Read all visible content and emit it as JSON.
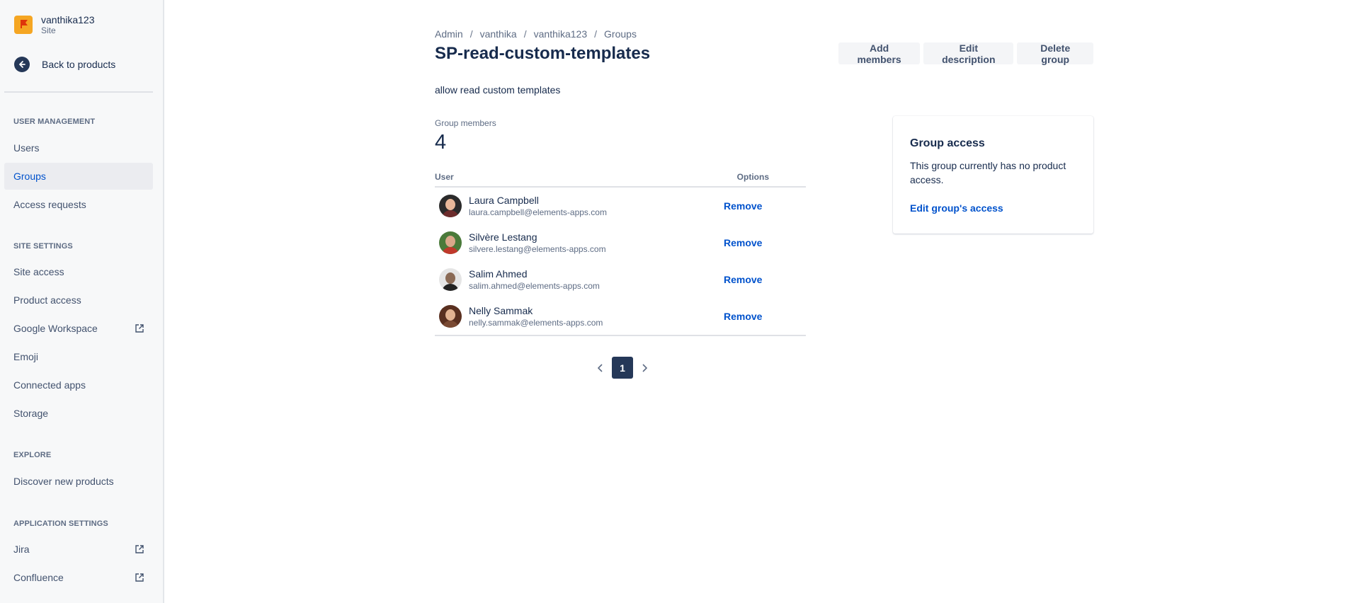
{
  "sidebar": {
    "site_name": "vanthika123",
    "site_type": "Site",
    "back_label": "Back to products",
    "sections": {
      "user_management": "USER MANAGEMENT",
      "site_settings": "SITE SETTINGS",
      "explore": "EXPLORE",
      "application_settings": "APPLICATION SETTINGS"
    },
    "items": {
      "users": "Users",
      "groups": "Groups",
      "access_requests": "Access requests",
      "site_access": "Site access",
      "product_access": "Product access",
      "google_workspace": "Google Workspace",
      "emoji": "Emoji",
      "connected_apps": "Connected apps",
      "storage": "Storage",
      "discover": "Discover new products",
      "jira": "Jira",
      "confluence": "Confluence"
    },
    "active_item": "Groups"
  },
  "breadcrumb": [
    "Admin",
    "vanthika",
    "vanthika123",
    "Groups"
  ],
  "page": {
    "title": "SP-read-custom-templates",
    "description": "allow read custom templates",
    "members_label": "Group members",
    "members_count": "4"
  },
  "actions": {
    "add_members": "Add members",
    "edit_description": "Edit description",
    "delete_group": "Delete group"
  },
  "table": {
    "col_user": "User",
    "col_options": "Options",
    "rows": [
      {
        "name": "Laura Campbell",
        "email": "laura.campbell@elements-apps.com",
        "action": "Remove"
      },
      {
        "name": "Silvère Lestang",
        "email": "silvere.lestang@elements-apps.com",
        "action": "Remove"
      },
      {
        "name": "Salim Ahmed",
        "email": "salim.ahmed@elements-apps.com",
        "action": "Remove"
      },
      {
        "name": "Nelly Sammak",
        "email": "nelly.sammak@elements-apps.com",
        "action": "Remove"
      }
    ]
  },
  "pagination": {
    "current_page": "1"
  },
  "access_card": {
    "title": "Group access",
    "body": "This group currently has no product access.",
    "link": "Edit group's access"
  },
  "colors": {
    "link": "#0052cc",
    "nav_active_bg": "#ebecf0",
    "sidebar_bg": "#f7f8f9",
    "page_number_bg": "#253858",
    "logo_bg": "#f5a623"
  }
}
